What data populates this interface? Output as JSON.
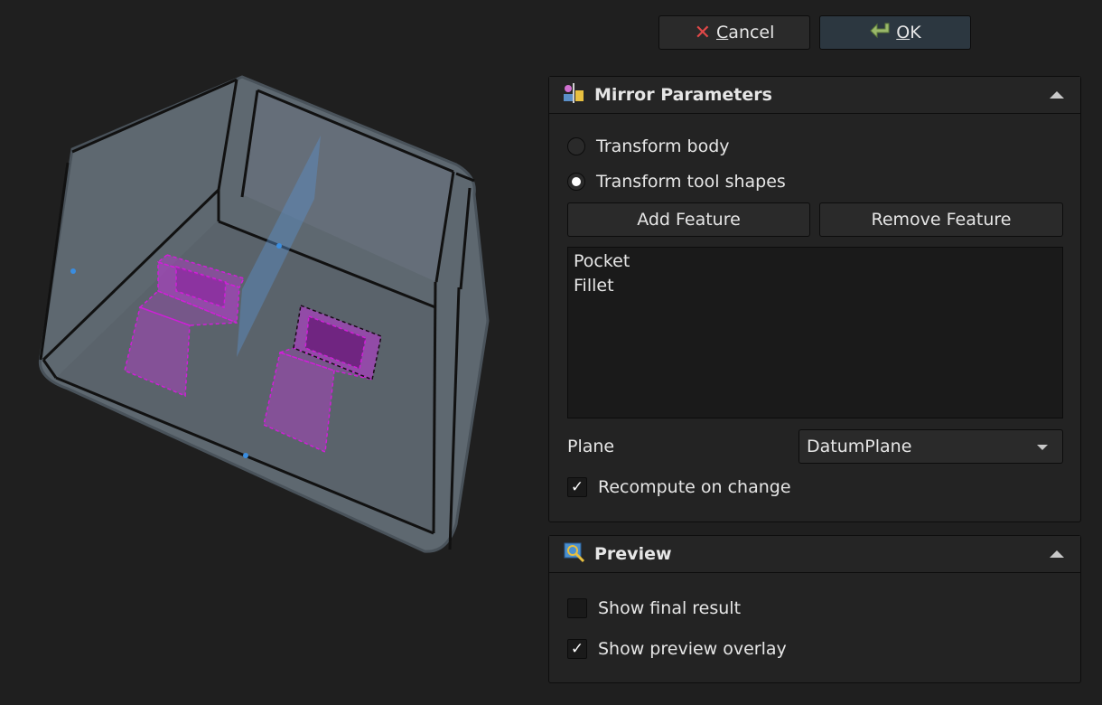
{
  "dialog": {
    "cancel": {
      "prefix": "",
      "underlined": "C",
      "rest": "ancel"
    },
    "ok": {
      "prefix": "",
      "underlined": "O",
      "rest": "K"
    }
  },
  "mirror_parameters": {
    "title": "Mirror Parameters",
    "transform_body": "Transform body",
    "transform_tool_shapes": "Transform tool shapes",
    "selected_mode": "transform_tool_shapes",
    "add_feature": "Add Feature",
    "remove_feature": "Remove Feature",
    "features": [
      "Pocket",
      "Fillet"
    ],
    "plane_label": "Plane",
    "plane_value": "DatumPlane",
    "recompute_label": "Recompute on change",
    "recompute_checked": true
  },
  "preview": {
    "title": "Preview",
    "show_final_result": "Show final result",
    "show_final_result_checked": false,
    "show_preview_overlay": "Show preview overlay",
    "show_preview_overlay_checked": true
  },
  "icons": {
    "cancel": "red-x-icon",
    "ok": "green-arrow-icon",
    "mirror": "mirror-parameters-icon",
    "preview": "preview-icon"
  },
  "colors": {
    "accent_magenta": "#d01ed8",
    "body_fill": "#5d6770",
    "plane_blue": "#5a8fc8"
  }
}
